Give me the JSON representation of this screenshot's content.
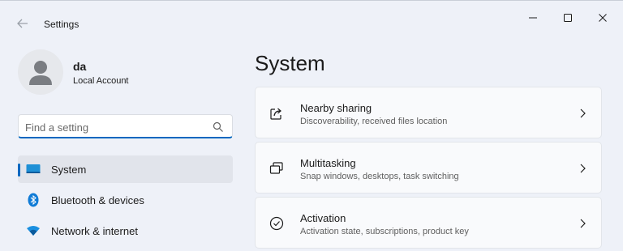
{
  "window": {
    "app_title": "Settings",
    "back_icon": "back-arrow-icon",
    "controls": [
      "minimize-icon",
      "maximize-icon",
      "close-icon"
    ]
  },
  "profile": {
    "name": "da",
    "account_type": "Local Account",
    "avatar_icon": "user-avatar-icon"
  },
  "search": {
    "placeholder": "Find a setting",
    "value": "",
    "icon": "search-icon"
  },
  "sidebar": {
    "items": [
      {
        "label": "System",
        "icon": "monitor-icon",
        "selected": true
      },
      {
        "label": "Bluetooth & devices",
        "icon": "bluetooth-icon",
        "selected": false
      },
      {
        "label": "Network & internet",
        "icon": "wifi-icon",
        "selected": false
      }
    ]
  },
  "main": {
    "title": "System",
    "cards": [
      {
        "title": "Nearby sharing",
        "subtitle": "Discoverability, received files location",
        "icon": "share-icon"
      },
      {
        "title": "Multitasking",
        "subtitle": "Snap windows, desktops, task switching",
        "icon": "multitasking-icon"
      },
      {
        "title": "Activation",
        "subtitle": "Activation state, subscriptions, product key",
        "icon": "activation-check-icon"
      }
    ]
  },
  "colors": {
    "accent": "#0067c0",
    "background": "#eef1f8",
    "card": "#f9fafc",
    "selected_nav": "#e1e4eb"
  }
}
